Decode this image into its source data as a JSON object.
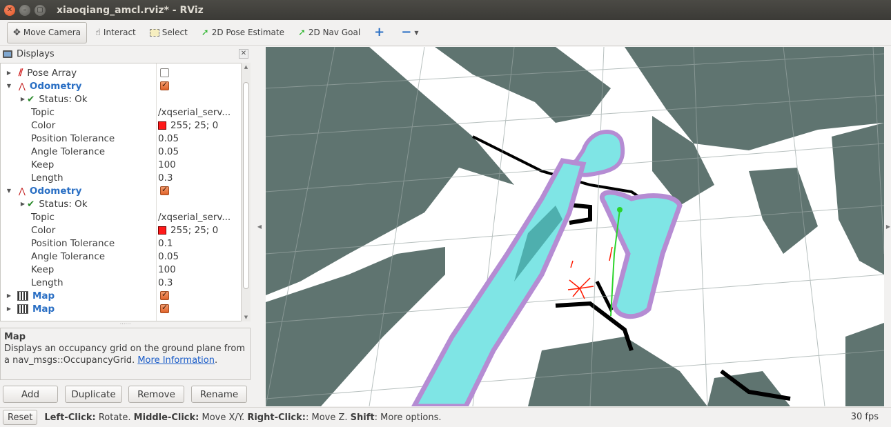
{
  "window": {
    "title": "xiaoqiang_amcl.rviz* - RViz"
  },
  "toolbar": {
    "tools": [
      {
        "label": "Move Camera",
        "icon": "move-camera-icon"
      },
      {
        "label": "Interact",
        "icon": "hand-icon"
      },
      {
        "label": "Select",
        "icon": "select-box-icon"
      },
      {
        "label": "2D Pose Estimate",
        "icon": "green-arrow-icon"
      },
      {
        "label": "2D Nav Goal",
        "icon": "green-arrow-icon"
      },
      {
        "label": "",
        "icon": "plus-icon"
      },
      {
        "label": "",
        "icon": "minus-dropdown-icon"
      }
    ]
  },
  "displays": {
    "header": "Displays",
    "rows": [
      {
        "label": "Pose Array",
        "checked": false
      },
      {
        "label": "Odometry",
        "checked": true
      },
      {
        "label": "Status: Ok"
      },
      {
        "label": "Topic",
        "value": "/xqserial_serv..."
      },
      {
        "label": "Color",
        "value": "255; 25; 0"
      },
      {
        "label": "Position Tolerance",
        "value": "0.05"
      },
      {
        "label": "Angle Tolerance",
        "value": "0.05"
      },
      {
        "label": "Keep",
        "value": "100"
      },
      {
        "label": "Length",
        "value": "0.3"
      },
      {
        "label": "Odometry",
        "checked": true
      },
      {
        "label": "Status: Ok"
      },
      {
        "label": "Topic",
        "value": "/xqserial_serv..."
      },
      {
        "label": "Color",
        "value": "255; 25; 0"
      },
      {
        "label": "Position Tolerance",
        "value": "0.1"
      },
      {
        "label": "Angle Tolerance",
        "value": "0.05"
      },
      {
        "label": "Keep",
        "value": "100"
      },
      {
        "label": "Length",
        "value": "0.3"
      },
      {
        "label": "Map",
        "checked": true
      },
      {
        "label": "Map",
        "checked": true
      }
    ]
  },
  "description": {
    "title": "Map",
    "text": "Displays an occupancy grid on the ground plane from a nav_msgs::OccupancyGrid.",
    "link": "More Information",
    "tail": "."
  },
  "buttons": {
    "add": "Add",
    "duplicate": "Duplicate",
    "remove": "Remove",
    "rename": "Rename"
  },
  "status": {
    "reset": "Reset",
    "hint_parts": [
      "Left-Click:",
      " Rotate. ",
      "Middle-Click:",
      " Move X/Y. ",
      "Right-Click:",
      ": Move Z. ",
      "Shift",
      ": More options."
    ],
    "fps": "30 fps"
  },
  "colors": {
    "map_unknown": "#5f7470",
    "inflation_cyan": "#7fe5e5",
    "inflation_purple": "#b58cd3",
    "odometry_red": "#ff1900",
    "path_green": "#2bd42b"
  }
}
